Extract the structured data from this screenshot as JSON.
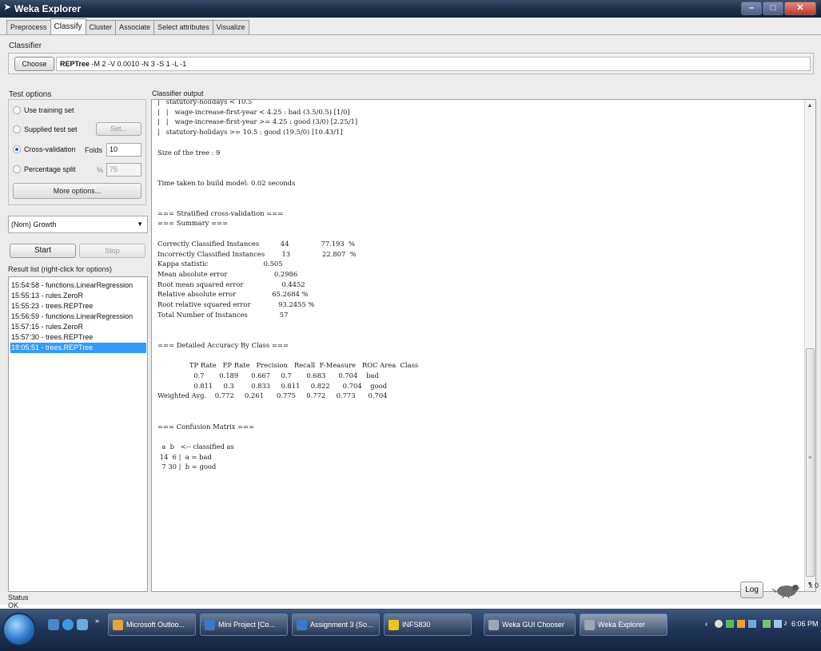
{
  "window": {
    "title": "Weka Explorer"
  },
  "tabs": [
    "Preprocess",
    "Classify",
    "Cluster",
    "Associate",
    "Select attributes",
    "Visualize"
  ],
  "classifier": {
    "label": "Classifier",
    "choose_label": "Choose",
    "name": "REPTree",
    "options": "-M 2 -V 0.0010 -N 3 -S 1 -L -1"
  },
  "test_options": {
    "label": "Test options",
    "use_training_set": "Use training set",
    "supplied_test_set": "Supplied test set",
    "set_label": "Set...",
    "cross_validation": "Cross-validation",
    "folds_label": "Folds",
    "folds_value": "10",
    "percentage_split": "Percentage split",
    "percent_label": "%",
    "percent_value": "75",
    "more_options": "More options..."
  },
  "class_select": {
    "value": "(Nom) Growth"
  },
  "run": {
    "start_label": "Start",
    "stop_label": "Stop"
  },
  "result_list": {
    "label": "Result list (right-click for options)",
    "items": [
      "15:54:58 - functions.LinearRegression",
      "15:55:13 - rules.ZeroR",
      "15:55:23 - trees.REPTree",
      "15:56:59 - functions.LinearRegression",
      "15:57:15 - rules.ZeroR",
      "15:57:30 - trees.REPTree",
      "18:05:51 - trees.REPTree"
    ],
    "selected_index": 6
  },
  "output": {
    "label": "Classifier output",
    "lines": [
      "|   statutory-holidays < 10.5",
      "|   |   wage-increase-first-year < 4.25 : bad (3.5/0.5) [1/0]",
      "|   |   wage-increase-first-year >= 4.25 : good (3/0) [2.25/1]",
      "|   statutory-holidays >= 10.5 : good (19.5/0) [10.43/1]",
      "",
      "Size of the tree : 9",
      "",
      "",
      "Time taken to build model: 0.02 seconds",
      "",
      "",
      "=== Stratified cross-validation ===",
      "=== Summary ===",
      "",
      "Correctly Classified Instances          44               77.193  %",
      "Incorrectly Classified Instances        13               22.807  %",
      "Kappa statistic                          0.505",
      "Mean absolute error                      0.2986",
      "Root mean squared error                  0.4452",
      "Relative absolute error                 65.2684 %",
      "Root relative squared error             93.2455 %",
      "Total Number of Instances               57",
      "",
      "",
      "=== Detailed Accuracy By Class ===",
      "",
      "               TP Rate   FP Rate   Precision   Recall  F-Measure   ROC Area  Class",
      "                 0.7       0.189      0.667     0.7       0.683      0.704    bad",
      "                 0.811     0.3        0.833     0.811     0.822      0.704    good",
      "Weighted Avg.    0.772     0.261      0.775     0.772     0.773      0.704",
      "",
      "",
      "=== Confusion Matrix ===",
      "",
      "  a  b   <-- classified as",
      " 14  6 |  a = bad",
      "  7 30 |  b = good"
    ]
  },
  "status": {
    "label": "Status",
    "text": "OK",
    "log_label": "Log",
    "count": "x 0"
  },
  "taskbar": {
    "items": [
      {
        "label": "Microsoft Outloo...",
        "color": "#e8a13a"
      },
      {
        "label": "Mini Project [Co...",
        "color": "#3b78c9"
      },
      {
        "label": "Assignment 3 (So...",
        "color": "#3b78c9"
      },
      {
        "label": "INFS830",
        "color": "#f0c419"
      },
      {
        "label": "Weka GUI Chooser",
        "color": "#9aa7b8"
      },
      {
        "label": "Weka Explorer",
        "color": "#9aa7b8"
      }
    ],
    "active_index": 5,
    "clock": "6:06 PM"
  }
}
